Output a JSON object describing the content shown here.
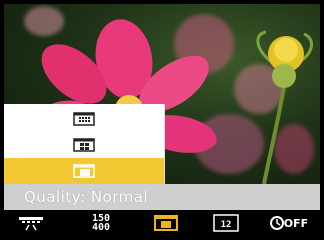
{
  "quality_label": "Quality: Normal",
  "submenu": {
    "options": [
      {
        "icon": "quality-fine-icon",
        "selected": false
      },
      {
        "icon": "quality-standard-icon",
        "selected": false
      },
      {
        "icon": "quality-normal-icon",
        "selected": true
      }
    ]
  },
  "toolbar": {
    "metering_icon": "metering-icon",
    "iso_top": "150",
    "iso_bottom": "400",
    "quality_icon": "quality-normal-icon",
    "size_text": "12",
    "selftimer_text": "OFF"
  },
  "colors": {
    "highlight": "#f3c832",
    "selected_icon": "#f3b21b",
    "labelbar": "#cfcfcf"
  }
}
